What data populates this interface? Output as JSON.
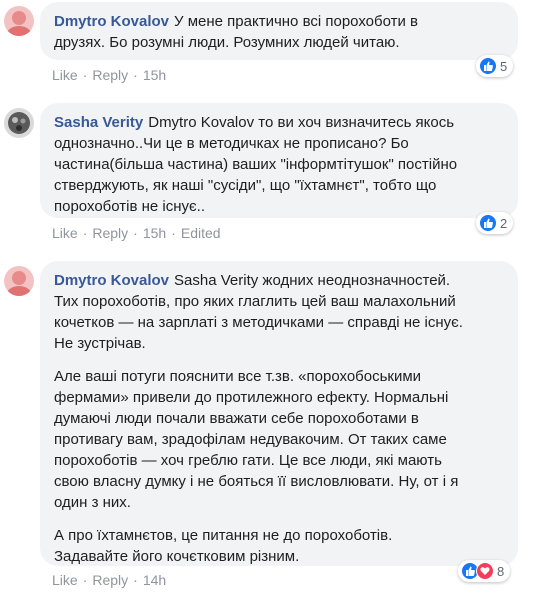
{
  "comments": [
    {
      "author": "Dmytro Kovalov",
      "text": "У мене практично всі порохоботи в\nдрузях. Бо розумні люди. Розумних людей читаю.",
      "like_label": "Like",
      "reply_label": "Reply",
      "time": "15h",
      "reaction_count": "5",
      "reaction_types": [
        "like-icon"
      ]
    },
    {
      "author": "Sasha Verity",
      "text": "Dmytro Kovalov то ви хоч визначитесь якось\nоднозначно..Чи це в методичках не прописано? Бо\nчастина(більша частина) ваших \"інформтітушок\" постійно\nстверджують, як наші \"сусіди\", що \"їхтамнєт\", тобто що\nпорохоботів не існує..",
      "like_label": "Like",
      "reply_label": "Reply",
      "time": "15h",
      "edited_label": "Edited",
      "reaction_count": "2",
      "reaction_types": [
        "like-icon"
      ]
    },
    {
      "author": "Dmytro Kovalov",
      "paragraphs": [
        "Sasha Verity жодних неоднозначностей.\nТих порохоботів, про яких глаглить цей ваш малахольний\nкочетков — на зарплаті з методичками — справді не існує.\nНе зустрічав.",
        "Але ваші потуги пояснити все т.зв. «порохобоськими\nфермами» привели до протилежного ефекту. Нормальні\nдумаючі люди почали вважати себе порохоботами в\nпротивагу вам, зрадофілам недувакочим. От таких саме\nпорохоботів — хоч греблю гати. Це все люди, які мають\nсвою власну думку і не бояться її висловлювати. Ну, от і я\nодин з них.",
        "А про їхтамнєтов, це питання не до порохоботів.\nЗадавайте його кочєтковим різним."
      ],
      "like_label": "Like",
      "reply_label": "Reply",
      "time": "14h",
      "reaction_count": "8",
      "reaction_types": [
        "like-icon",
        "love-icon"
      ]
    }
  ],
  "colors": {
    "author": "#385898",
    "bubble": "#f2f3f5",
    "meta": "#90949c",
    "like": "#1877f2",
    "love": "#f33e58"
  }
}
